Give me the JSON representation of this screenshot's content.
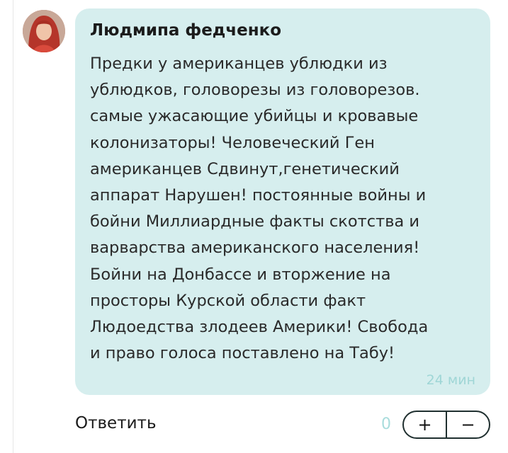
{
  "comment": {
    "author": "Людмипа федченко",
    "lines": [
      "Предки у американцев ублюдки из",
      "ублюдков, головорезы из головорезов.",
      "самые ужасающие убийцы и кровавые",
      "колонизаторы! Человеческий Ген",
      "американцев Сдвинут,генетический",
      "аппарат Нарушен! постоянные войны и",
      "бойни Миллиардные факты скотства и",
      "варварства американского населения!",
      "Бойни на Донбассе и вторжение на",
      "просторы Курской области факт",
      "Людоедства злодеев Америки! Свобода",
      "и право голоса поставлено на Табу!"
    ],
    "time": "24 мин"
  },
  "actions": {
    "reply_label": "Ответить",
    "score": "0",
    "plus": "+",
    "minus": "−"
  },
  "colors": {
    "bubble": "#d6eeee",
    "accent_light": "#9fd6d6"
  }
}
